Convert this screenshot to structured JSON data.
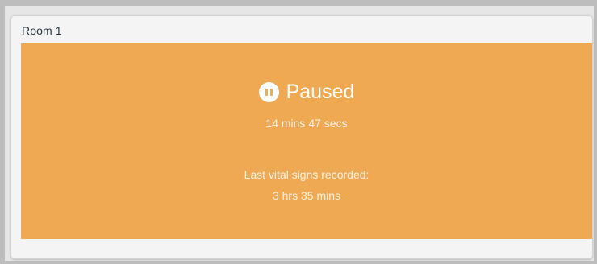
{
  "card": {
    "title": "Room 1"
  },
  "status": {
    "label": "Paused",
    "icon": "pause-circle-icon",
    "elapsed": "14 mins 47 secs",
    "color": "#efa953"
  },
  "vitals": {
    "label": "Last vital signs recorded:",
    "value": "3 hrs 35 mins"
  }
}
